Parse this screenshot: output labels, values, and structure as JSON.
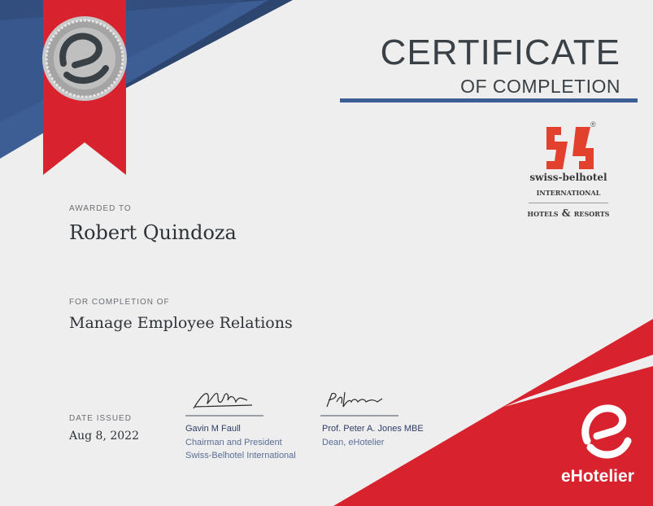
{
  "certificate": {
    "title": "CERTIFICATE",
    "subtitle": "OF COMPLETION",
    "awarded_label": "AWARDED TO",
    "recipient": "Robert Quindoza",
    "completion_label": "FOR COMPLETION OF",
    "course": "Manage Employee Relations",
    "date_label": "DATE ISSUED",
    "date": "Aug 8, 2022"
  },
  "signatories": [
    {
      "name": "Gavin M Faull",
      "title": "Chairman and President",
      "org": "Swiss-Belhotel International"
    },
    {
      "name": "Prof. Peter A. Jones MBE",
      "title": "Dean, eHotelier"
    }
  ],
  "brand": {
    "line1": "swiss-belhotel",
    "line2": "international",
    "line3": "hotels & resorts",
    "registered": "®"
  },
  "footer_logo": {
    "text": "eHotelier"
  },
  "colors": {
    "red": "#d8232f",
    "blue": "#3d5e95",
    "dark_blue": "#2c4670",
    "text": "#3a4146"
  }
}
